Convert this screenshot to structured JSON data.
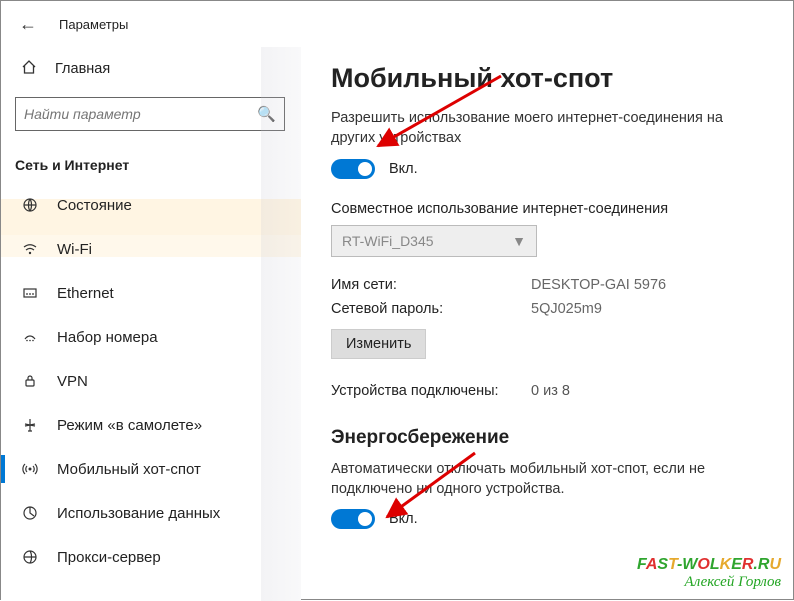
{
  "header": {
    "title": "Параметры"
  },
  "sidebar": {
    "home": "Главная",
    "search_placeholder": "Найти параметр",
    "category": "Сеть и Интернет",
    "items": [
      {
        "label": "Состояние"
      },
      {
        "label": "Wi-Fi"
      },
      {
        "label": "Ethernet"
      },
      {
        "label": "Набор номера"
      },
      {
        "label": "VPN"
      },
      {
        "label": "Режим «в самолете»"
      },
      {
        "label": "Мобильный хот-спот"
      },
      {
        "label": "Использование данных"
      },
      {
        "label": "Прокси-сервер"
      }
    ]
  },
  "main": {
    "title": "Мобильный хот-спот",
    "share_desc": "Разрешить использование моего интернет-соединения на других устройствах",
    "toggle1_state": "Вкл.",
    "share_from_label": "Совместное использование интернет-соединения",
    "share_from_value": "RT-WiFi_D345",
    "net_name_label": "Имя сети:",
    "net_name_value": "DESKTOP-GAI 5976",
    "net_pass_label": "Сетевой пароль:",
    "net_pass_value": "5QJ025m9",
    "edit_btn": "Изменить",
    "devices_label": "Устройства подключены:",
    "devices_value": "0 из 8",
    "power_title": "Энергосбережение",
    "power_desc": "Автоматически отключать мобильный хот-спот, если не подключено ни одного устройства.",
    "toggle2_state": "Вкл."
  },
  "watermark": {
    "l1_parts": [
      "F",
      "A",
      "S",
      "T",
      "-",
      "W",
      "O",
      "L",
      "K",
      "E",
      "R",
      ".",
      "R",
      "U"
    ],
    "l2": "Алексей Горлов"
  }
}
